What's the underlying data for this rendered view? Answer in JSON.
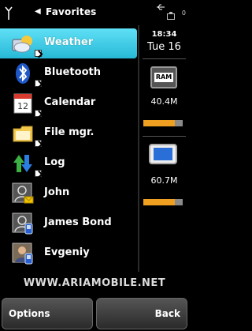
{
  "status": {
    "title": "Favorites",
    "battery_level": "0"
  },
  "list": {
    "items": [
      {
        "label": "Weather",
        "icon": "weather-icon",
        "selected": true
      },
      {
        "label": "Bluetooth",
        "icon": "bluetooth-icon",
        "selected": false
      },
      {
        "label": "Calendar",
        "icon": "calendar-icon",
        "selected": false
      },
      {
        "label": "File mgr.",
        "icon": "folder-icon",
        "selected": false
      },
      {
        "label": "Log",
        "icon": "log-icon",
        "selected": false
      },
      {
        "label": "John",
        "icon": "contact-icon",
        "selected": false
      },
      {
        "label": "James Bond",
        "icon": "contact-icon",
        "selected": false
      },
      {
        "label": "Evgeniy",
        "icon": "contact-photo-icon",
        "selected": false
      }
    ]
  },
  "panel": {
    "time": "18:34",
    "date": "Tue 16",
    "ram_label": "RAM",
    "ram_value": "40.4M",
    "ram_used_fraction": 0.8,
    "storage_value": "60.7M",
    "storage_used_fraction": 0.8
  },
  "watermark": "WWW.ARIAMOBILE.NET",
  "softkeys": {
    "left": "Options",
    "right": "Back"
  },
  "colors": {
    "selection": "#27b8d6",
    "bar_fill": "#f0a020",
    "bar_track": "#8a8a8a"
  }
}
